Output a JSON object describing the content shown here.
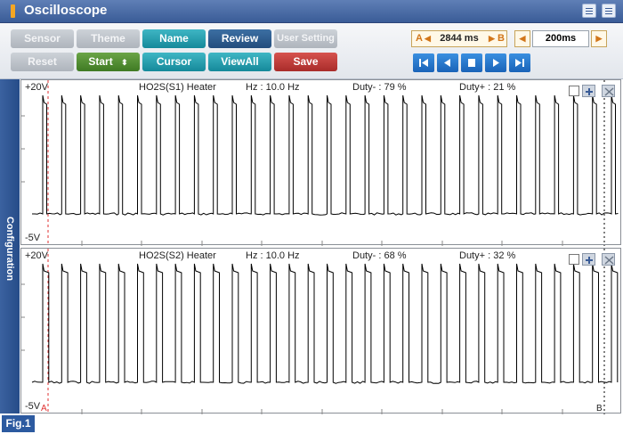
{
  "window": {
    "title": "Oscilloscope"
  },
  "toolbar": {
    "row1": [
      {
        "label": "Sensor",
        "style": "gray"
      },
      {
        "label": "Theme",
        "style": "gray"
      },
      {
        "label": "Name",
        "style": "teal"
      },
      {
        "label": "Review",
        "style": "navy"
      },
      {
        "label": "User Setting",
        "style": "gray"
      }
    ],
    "row2": [
      {
        "label": "Reset",
        "style": "gray"
      },
      {
        "label": "Start",
        "style": "green"
      },
      {
        "label": "Cursor",
        "style": "teal"
      },
      {
        "label": "ViewAll",
        "style": "teal"
      },
      {
        "label": "Save",
        "style": "red"
      }
    ],
    "cursor_a_label": "A",
    "cursor_b_label": "B",
    "time_value": "2844 ms",
    "timebase_value": "200ms",
    "playback": [
      "skip-start-icon",
      "step-back-icon",
      "stop-icon",
      "play-icon",
      "skip-end-icon"
    ]
  },
  "sidebar": {
    "label": "Configuration"
  },
  "panels": [
    {
      "top_label": "+20V",
      "bottom_label": "-5V",
      "sensor": "HO2S(S1) Heater",
      "hz": "Hz : 10.0 Hz",
      "duty_minus": "Duty- : 79 %",
      "duty_plus": "Duty+ : 21 %",
      "duty_fraction": 0.21
    },
    {
      "top_label": "+20V",
      "bottom_label": "-5V",
      "sensor": "HO2S(S2) Heater",
      "hz": "Hz : 10.0 Hz",
      "duty_minus": "Duty- : 68 %",
      "duty_plus": "Duty+ : 32 %",
      "duty_fraction": 0.32
    }
  ],
  "markers": {
    "a": "A",
    "b": "B"
  },
  "figure_label": "Fig.1",
  "colors": {
    "accent": "#3a5c97",
    "cursor_a": "#e03030",
    "trace": "#000000"
  }
}
